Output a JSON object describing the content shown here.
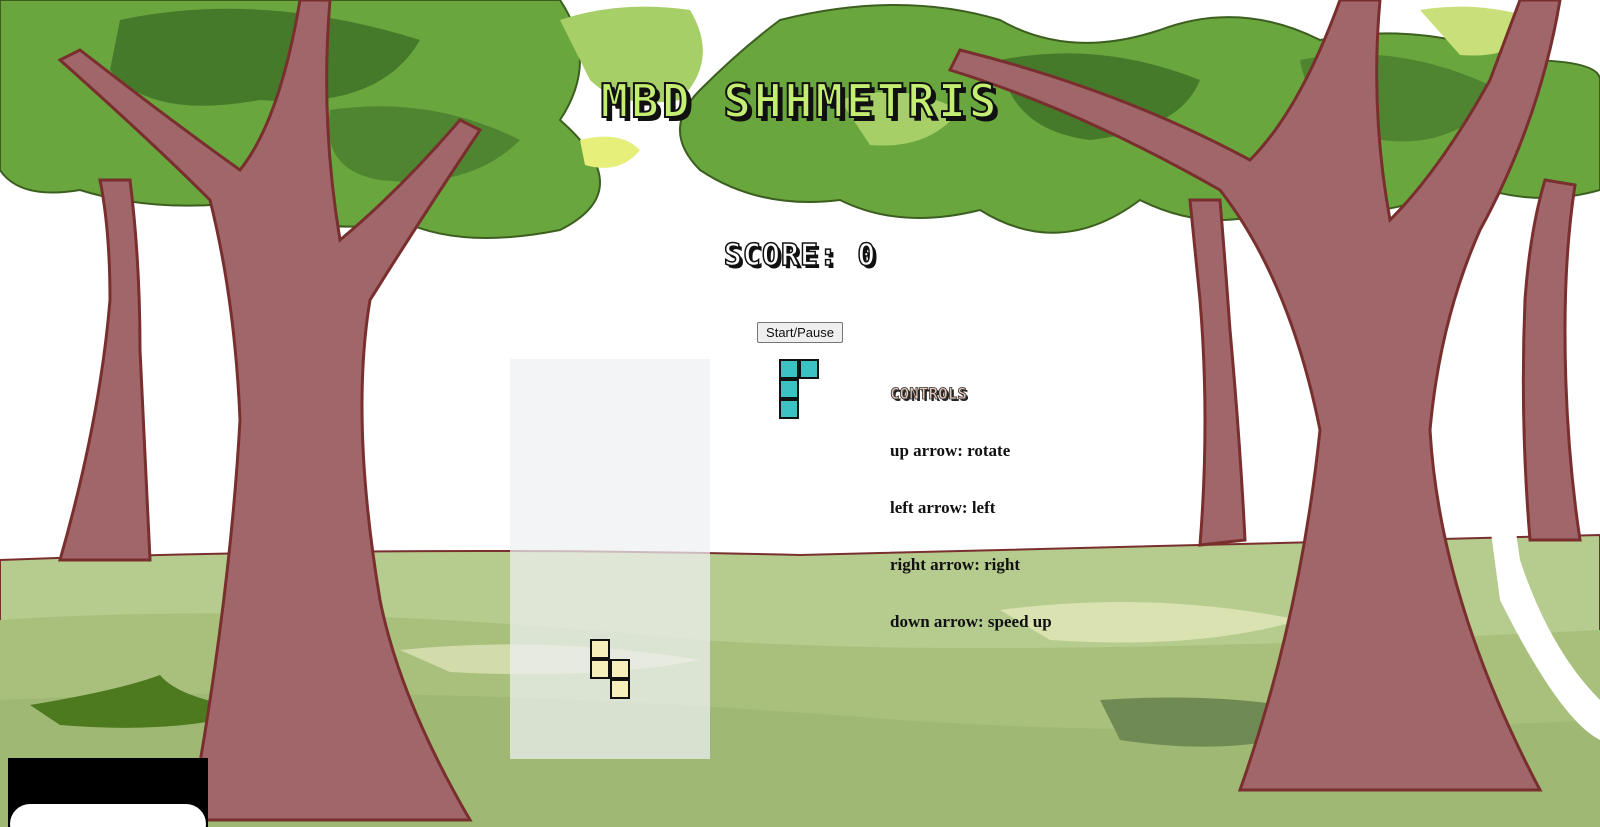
{
  "game": {
    "title": "MBD SHHMETRIS",
    "score_label": "SCORE:",
    "score_value": "0",
    "start_pause_label": "Start/Pause"
  },
  "board": {
    "columns": 10,
    "rows": 20,
    "active_piece": {
      "color": "#f6eebb",
      "cells": [
        [
          4,
          14
        ],
        [
          4,
          15
        ],
        [
          5,
          15
        ],
        [
          5,
          16
        ]
      ]
    }
  },
  "next_piece": {
    "color": "#3bc3c3",
    "cells": [
      [
        0,
        0
      ],
      [
        1,
        0
      ],
      [
        0,
        1
      ],
      [
        0,
        2
      ]
    ]
  },
  "controls": {
    "heading": "CONTROLS",
    "items": [
      "up arrow: rotate",
      "left arrow: left",
      "right arrow: right",
      "down arrow: speed up"
    ]
  },
  "colors": {
    "title": "#c4ee72",
    "board_background": "#eef0f2",
    "trunk": "#a0666a",
    "foliage": "#6aa63e",
    "grass": "#b5c98a"
  }
}
